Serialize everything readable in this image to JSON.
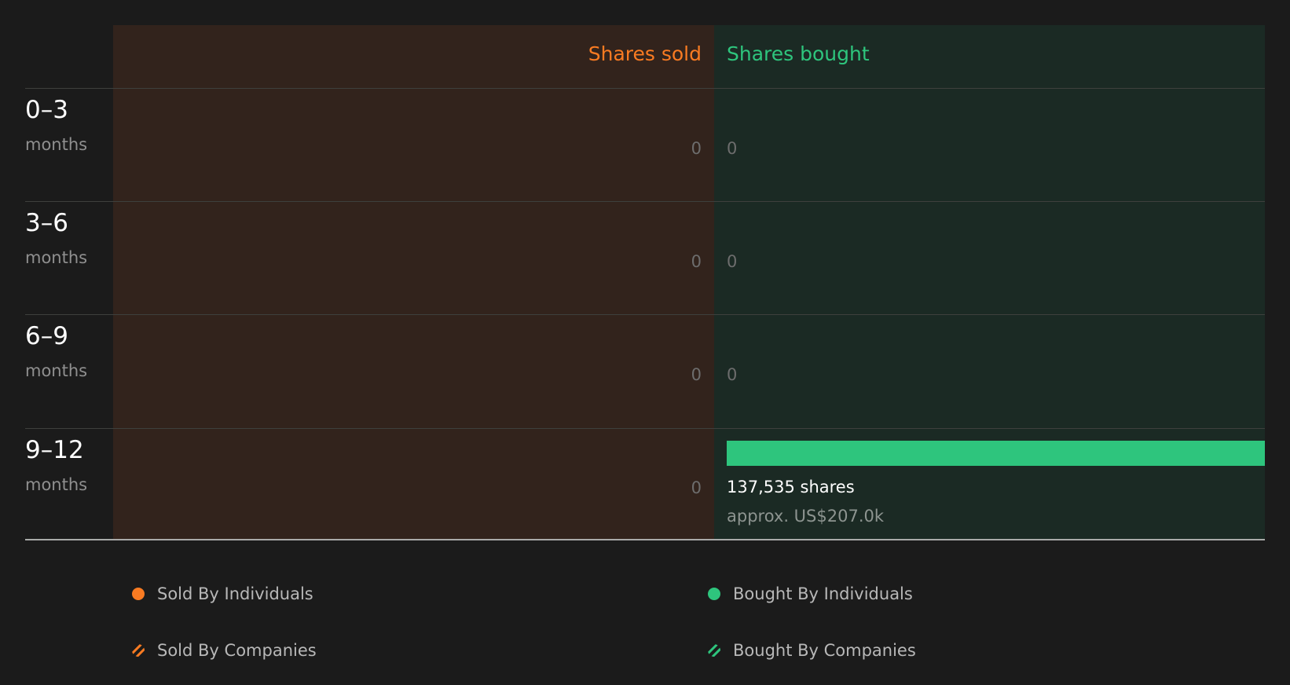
{
  "colors": {
    "sold": "#f97b22",
    "bought": "#2ec57d",
    "sold_panel": "#32231c",
    "bought_panel": "#1b2a24",
    "background": "#1b1b1b"
  },
  "headers": {
    "sold": "Shares sold",
    "bought": "Shares bought"
  },
  "chart_data": {
    "type": "bar",
    "title": "",
    "categories": [
      "0–3 months",
      "3–6 months",
      "6–9 months",
      "9–12 months"
    ],
    "series": [
      {
        "name": "Shares sold",
        "values": [
          0,
          0,
          0,
          0
        ]
      },
      {
        "name": "Shares bought",
        "values": [
          0,
          0,
          0,
          137535
        ]
      }
    ],
    "xlabel": "",
    "ylabel": "",
    "grid": true,
    "legend": "bottom"
  },
  "rows": [
    {
      "range": "0–3",
      "unit": "months",
      "sold_label": "0",
      "bought_label": "0"
    },
    {
      "range": "3–6",
      "unit": "months",
      "sold_label": "0",
      "bought_label": "0"
    },
    {
      "range": "6–9",
      "unit": "months",
      "sold_label": "0",
      "bought_label": "0"
    },
    {
      "range": "9–12",
      "unit": "months",
      "sold_label": "0",
      "bought_shares": "137,535 shares",
      "bought_approx": "approx. US$207.0k"
    }
  ],
  "legend": {
    "sold_individuals": "Sold By Individuals",
    "bought_individuals": "Bought By Individuals",
    "sold_companies": "Sold By Companies",
    "bought_companies": "Bought By Companies"
  }
}
